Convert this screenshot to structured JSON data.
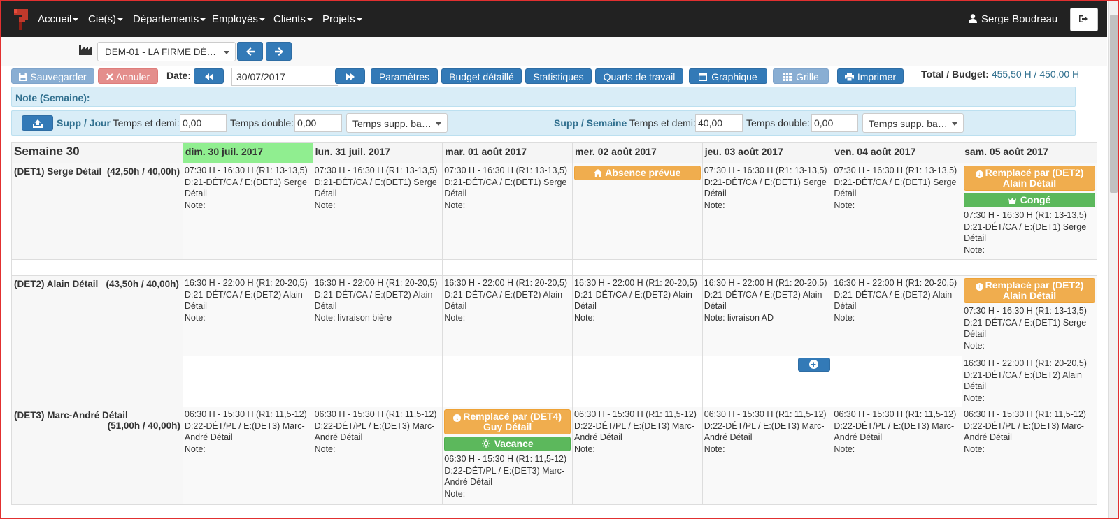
{
  "nav": {
    "items": [
      "Accueil",
      "Cie(s)",
      "Départements",
      "Employés",
      "Clients",
      "Projets"
    ],
    "user": "Serge Boudreau"
  },
  "dept_select": "DEM-01 - LA FIRME DÉ…",
  "toolbar": {
    "save": "Sauvegarder",
    "cancel": "Annuler",
    "date_label": "Date:",
    "date_value": "30/07/2017",
    "params": "Paramètres",
    "budget": "Budget détaillé",
    "stats": "Statistiques",
    "shifts": "Quarts de travail",
    "graph": "Graphique",
    "grid": "Grille",
    "print": "Imprimer",
    "total_label": "Total / Budget:",
    "total_value": "455,50 H / 450,00 H"
  },
  "note_label": "Note (Semaine):",
  "overtime": {
    "day_title_a": "Supp",
    "day_title_b": "Jour",
    "week_title_a": "Supp",
    "week_title_b": "Semaine",
    "sep": "/",
    "time_half_label": "Temps et demi:",
    "double_label": "Temps double:",
    "day_half": "0,00",
    "day_double": "0,00",
    "week_half": "40,00",
    "week_double": "0,00",
    "select_text": "Temps supp. ba…"
  },
  "schedule": {
    "week": "Semaine 30",
    "days": [
      "dim. 30 juil. 2017",
      "lun. 31 juil. 2017",
      "mar. 01 août 2017",
      "mer. 02 août 2017",
      "jeu. 03 août 2017",
      "ven. 04 août 2017",
      "sam. 05 août 2017"
    ],
    "det1": {
      "name": "(DET1) Serge Détail",
      "hours": "(42,50h / 40,00h)",
      "shift": "07:30 H - 16:30 H (R1: 13-13,5)",
      "dept": "D:21-DÉT/CA / E:(DET1) Serge Détail",
      "note": "Note:",
      "absence": "Absence prévue",
      "replaced": "Remplacé par (DET2) Alain Détail",
      "conge": "Congé"
    },
    "det2": {
      "name": "(DET2) Alain Détail",
      "hours": "(43,50h / 40,00h)",
      "shift": "16:30 H - 22:00 H (R1: 20-20,5)",
      "dept": "D:21-DÉT/CA / E:(DET2) Alain Détail",
      "note": "Note:",
      "note_mon": "Note: livraison bière",
      "note_thu": "Note: livraison AD",
      "replaced": "Remplacé par (DET2) Alain Détail",
      "sat_shift": "07:30 H - 16:30 H (R1: 13-13,5)",
      "sat_dept": "D:21-DÉT/CA / E:(DET1) Serge Détail"
    },
    "det3": {
      "name": "(DET3) Marc-André Détail",
      "hours": "(51,00h / 40,00h)",
      "shift": "06:30 H - 15:30 H (R1: 11,5-12)",
      "dept": "D:22-DÉT/PL / E:(DET3) Marc-André Détail",
      "note": "Note:",
      "replaced": "Remplacé par (DET4) Guy Détail",
      "vacance": "Vacance"
    }
  }
}
